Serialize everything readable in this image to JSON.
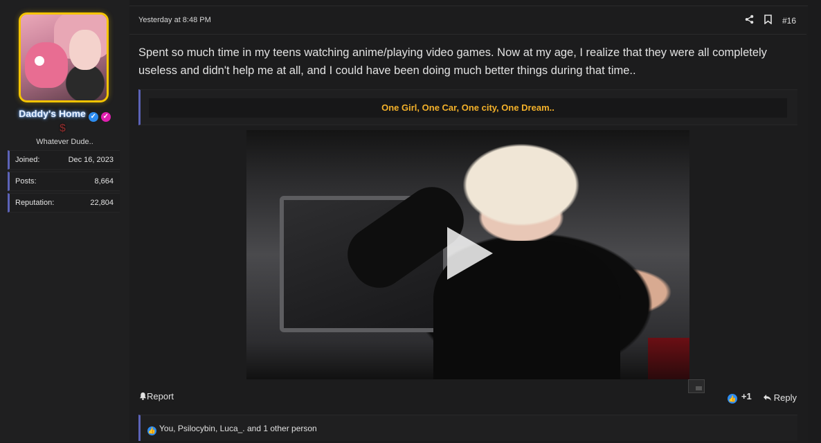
{
  "user": {
    "username": "Daddy's Home",
    "title": "Whatever Dude..",
    "stats": [
      {
        "label": "Joined:",
        "value": "Dec 16, 2023"
      },
      {
        "label": "Posts:",
        "value": "8,664"
      },
      {
        "label": "Reputation:",
        "value": "22,804"
      }
    ],
    "badge_verified": "✓",
    "badge_pink": "✓",
    "dollar_glyph": "$"
  },
  "post": {
    "date": "Yesterday at 8:48 PM",
    "number": "#16",
    "body": "Spent so much time in my teens watching anime/playing video games. Now at my age, I realize that they were all completely useless and didn't help me at all, and I could have been doing much better things during that time..",
    "signature_quote": "One Girl, One Car, One city, One Dream..",
    "report_label": "Report",
    "reaction_count": "+1",
    "reply_label": "Reply",
    "likes_summary": "You, Psilocybin, Luca_. and 1 other person"
  },
  "colors": {
    "accent_border": "#5c63b8",
    "quote_text": "#f3b12a",
    "avatar_border": "#f5c400",
    "like_blue": "#2d8cf0"
  },
  "icons": [
    "share-icon",
    "bookmark-icon",
    "bell-icon",
    "like-icon",
    "reply-icon",
    "play-icon",
    "pip-icon",
    "verified-badge-icon",
    "dollar-icon"
  ]
}
